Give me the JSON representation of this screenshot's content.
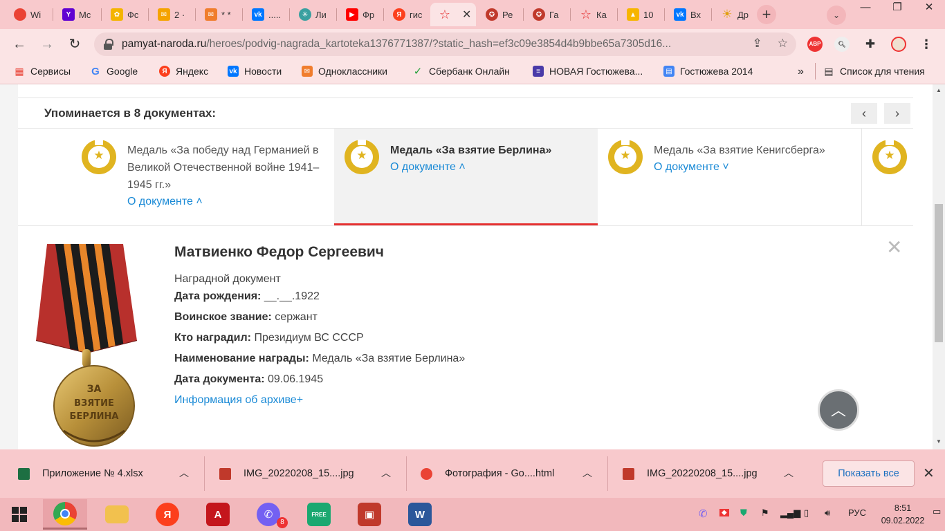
{
  "window": {
    "minimize": "—",
    "maximize": "❐",
    "close": "✕"
  },
  "tabs": [
    {
      "label": "Wi",
      "icon": "chrome-icon",
      "color": "#ea4335"
    },
    {
      "label": "Mc",
      "icon": "yahoo-icon",
      "color": "#6001d2"
    },
    {
      "label": "Фс",
      "icon": "photos-icon",
      "color": "#f4b400"
    },
    {
      "label": "2 ·",
      "icon": "mail-icon",
      "color": "#f5a300"
    },
    {
      "label": "* *",
      "icon": "mail-icon",
      "color": "#f07d2d"
    },
    {
      "label": ".....",
      "icon": "vk-icon",
      "color": "#0077ff"
    },
    {
      "label": "Ли",
      "icon": "compass-icon",
      "color": "#3aa0a0"
    },
    {
      "label": "Фр",
      "icon": "youtube-icon",
      "color": "#ff0000"
    },
    {
      "label": "гис",
      "icon": "yandex-icon",
      "color": "#fc3f1d"
    },
    {
      "label": "",
      "icon": "star-icon",
      "color": "#e53030",
      "active": true
    },
    {
      "label": "Ре",
      "icon": "medal-icon",
      "color": "#c0392b"
    },
    {
      "label": "Га",
      "icon": "medal-icon",
      "color": "#c0392b"
    },
    {
      "label": "Ка",
      "icon": "star-icon",
      "color": "#e53030"
    },
    {
      "label": "10",
      "icon": "picture-icon",
      "color": "#f7b500"
    },
    {
      "label": "Вх",
      "icon": "vk-icon",
      "color": "#0077ff"
    },
    {
      "label": "Др",
      "icon": "sun-icon",
      "color": "#f0c020"
    }
  ],
  "toolbar": {
    "back": "←",
    "forward": "→",
    "reload": "↻",
    "url_host": "pamyat-naroda.ru",
    "url_path": "/heroes/podvig-nagrada_kartoteka1376771387/?static_hash=ef3c09e3854d4b9bbe65a7305d16...",
    "share": "⇪",
    "bookmark_star": "☆",
    "ext_abp": "ABP",
    "ext_puzzle": "✚",
    "menu": "⋮"
  },
  "bookmarks": [
    {
      "label": "Сервисы",
      "icon": "apps-grid-icon",
      "color": "#e94235"
    },
    {
      "label": "Google",
      "icon": "google-icon",
      "color": "#4285f4"
    },
    {
      "label": "Яндекс",
      "icon": "yandex-icon",
      "color": "#fc3f1d"
    },
    {
      "label": "Новости",
      "icon": "vk-icon",
      "color": "#0077ff"
    },
    {
      "label": "Одноклассники",
      "icon": "mail-icon",
      "color": "#f07d2d"
    },
    {
      "label": "Сбербанк Онлайн",
      "icon": "sberbank-icon",
      "color": "#21a038"
    },
    {
      "label": "НОВАЯ Гостюжева...",
      "icon": "form-icon",
      "color": "#4a3aa8"
    },
    {
      "label": "Гостюжева 2014",
      "icon": "sheet-icon",
      "color": "#4285f4"
    }
  ],
  "bookmarks_more": "»",
  "reading_list": "Список для чтения",
  "page": {
    "mentions_title": "Упоминается в 8 документах:",
    "prev": "‹",
    "next": "›",
    "awards": [
      {
        "name": "Медаль «За победу над Германией в Великой Отечественной войне 1941–1945 гг.»",
        "link": "О документе ˄"
      },
      {
        "name": "Медаль «За взятие Берлина»",
        "link": "О документе ˄"
      },
      {
        "name": "Медаль «За взятие Кенигсберга»",
        "link": "О документе ˅"
      }
    ],
    "person_name": "Матвиенко Федор Сергеевич",
    "doc_type": "Наградной документ",
    "fields": [
      {
        "label": "Дата рождения:",
        "value": " __.__.1922"
      },
      {
        "label": "Воинское звание:",
        "value": " сержант"
      },
      {
        "label": "Кто наградил:",
        "value": " Президиум ВС СССР"
      },
      {
        "label": "Наименование награды:",
        "value": " Медаль «За взятие Берлина»"
      },
      {
        "label": "Дата документа:",
        "value": " 09.06.1945"
      }
    ],
    "archive_link": "Информация об архиве+",
    "close": "✕",
    "up": "︿",
    "medal_text_1": "ЗА",
    "medal_text_2": "ВЗЯТИЕ",
    "medal_text_3": "БЕРЛИНА"
  },
  "downloads": [
    {
      "name": "Приложение № 4.xlsx",
      "icon": "excel-icon",
      "color": "#1d6f42"
    },
    {
      "name": "IMG_20220208_15....jpg",
      "icon": "image-file-icon",
      "color": "#c0392b"
    },
    {
      "name": "Фотография - Go....html",
      "icon": "chrome-icon",
      "color": "#ea4335"
    },
    {
      "name": "IMG_20220208_15....jpg",
      "icon": "image-file-icon",
      "color": "#c0392b"
    }
  ],
  "downloads_chevron": "︿",
  "show_all": "Показать все",
  "downloads_close": "✕",
  "taskbar": {
    "apps": [
      {
        "name": "chrome",
        "label": "",
        "color": "#4285f4"
      },
      {
        "name": "file-explorer",
        "label": "",
        "color": "#f2c14e"
      },
      {
        "name": "yandex",
        "label": "Я",
        "color": "#fc3f1d"
      },
      {
        "name": "acrobat",
        "label": "A",
        "color": "#c4161c"
      },
      {
        "name": "viber",
        "label": "✆",
        "color": "#7360f2"
      },
      {
        "name": "free-vpn",
        "label": "FREE",
        "color": "#1aa870"
      },
      {
        "name": "picture-viewer",
        "label": "▣",
        "color": "#c0392b"
      },
      {
        "name": "word",
        "label": "W",
        "color": "#2b579a"
      }
    ],
    "viber_badge": "8",
    "lang": "РУС",
    "time": "8:51",
    "date": "09.02.2022"
  }
}
